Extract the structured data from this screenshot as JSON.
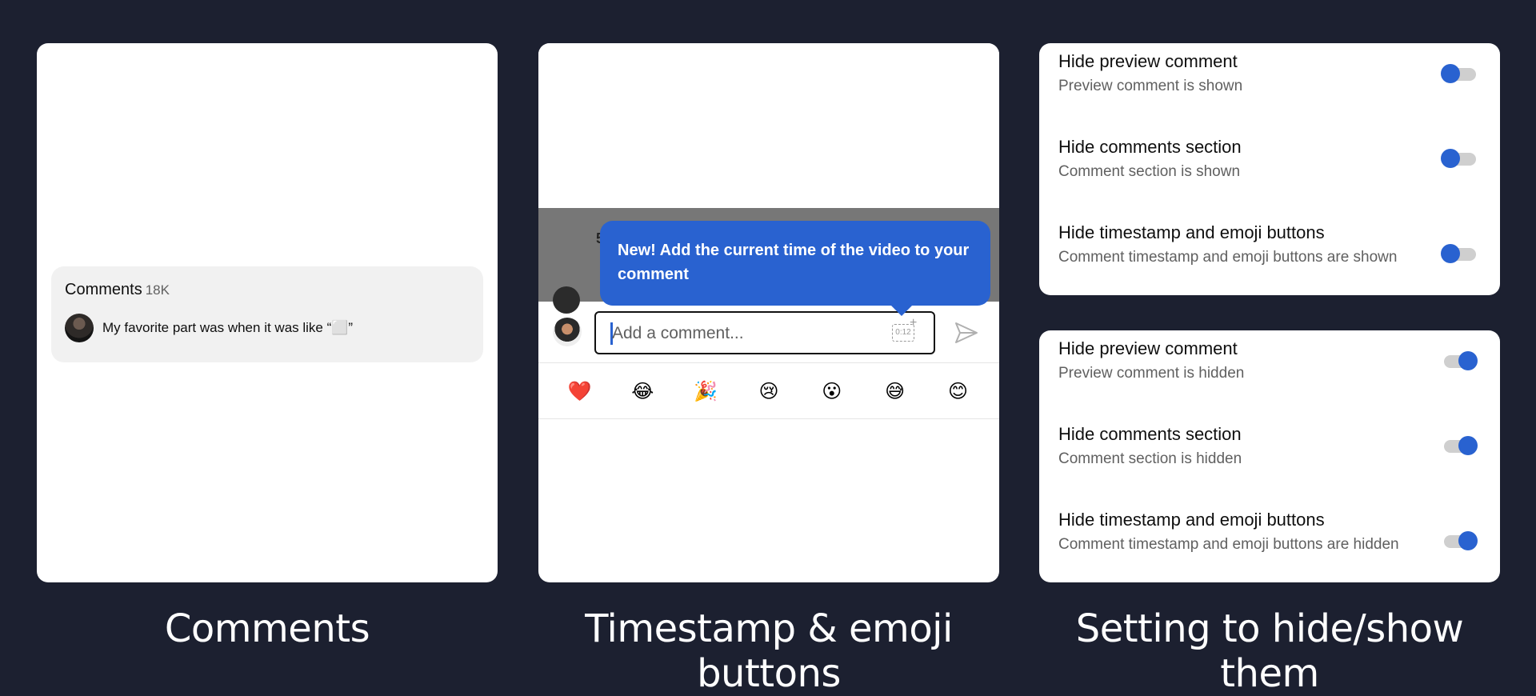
{
  "panels": {
    "comments": {
      "header_label": "Comments",
      "count": "18K",
      "comment_text": "My favorite part was when it was like “⬜”"
    },
    "timestamp": {
      "peek_text": "5",
      "tooltip_text": "New! Add the current time of the video to your comment",
      "input_placeholder": "Add a comment...",
      "timestamp_icon_label": "0:12",
      "emojis": [
        "❤️",
        "😂",
        "🎉",
        "😢",
        "😮",
        "😅",
        "😊"
      ]
    }
  },
  "settings": {
    "shown": [
      {
        "title": "Hide preview comment",
        "subtitle": "Preview comment is shown",
        "enabled": false
      },
      {
        "title": "Hide comments section",
        "subtitle": "Comment section is shown",
        "enabled": false
      },
      {
        "title": "Hide timestamp and emoji buttons",
        "subtitle": "Comment timestamp and emoji buttons are shown",
        "enabled": false
      }
    ],
    "hidden": [
      {
        "title": "Hide preview comment",
        "subtitle": "Preview comment is hidden",
        "enabled": true
      },
      {
        "title": "Hide comments section",
        "subtitle": "Comment section is hidden",
        "enabled": true
      },
      {
        "title": "Hide timestamp and emoji buttons",
        "subtitle": "Comment timestamp and emoji buttons are hidden",
        "enabled": true
      }
    ]
  },
  "captions": {
    "comments": "Comments",
    "timestamp": "Timestamp & emoji buttons",
    "settings": "Setting to hide/show them"
  },
  "colors": {
    "background": "#1c2030",
    "accent": "#2962d0"
  }
}
